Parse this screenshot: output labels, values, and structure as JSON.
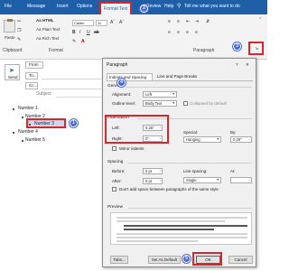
{
  "ribbon": {
    "tabs": [
      "File",
      "Message",
      "Insert",
      "Options",
      "Format Text",
      "Review",
      "Help"
    ],
    "search_text": "Tell me what you want to do",
    "format_group": {
      "as_html": "Aa HTML",
      "plain_text": "Aa Plain Text",
      "rich_text": "Aa Rich Text",
      "label": "Format"
    },
    "font": {
      "name": "Calibri",
      "size": "11"
    },
    "clipboard": {
      "paste": "Paste",
      "label": "Clipboard"
    },
    "paragraph_label": "Paragraph"
  },
  "email": {
    "from": "From",
    "to": "To...",
    "cc": "Cc...",
    "subject": "Subject",
    "send": "Send",
    "body": [
      "Number 1",
      "Number 2",
      "Number 3",
      "Number 4",
      "Number 5"
    ]
  },
  "callouts": [
    "1",
    "2",
    "3",
    "4",
    "5"
  ],
  "dialog": {
    "title": "Paragraph",
    "close": "✕",
    "help": "?",
    "tabs": [
      "Indents and Spacing",
      "Line and Page Breaks"
    ],
    "general": {
      "heading": "General",
      "alignment_label": "Alignment:",
      "alignment_value": "Left",
      "outline_label": "Outline level:",
      "outline_value": "Body Text",
      "collapsed": "Collapsed by default"
    },
    "indentation": {
      "heading": "Indentation",
      "left_label": "Left:",
      "left_value": "0.25\"",
      "right_label": "Right:",
      "right_value": "0\"",
      "special_label": "Special:",
      "special_value": "Hanging",
      "by_label": "By:",
      "by_value": "0.25\"",
      "mirror": "Mirror indents"
    },
    "spacing": {
      "heading": "Spacing",
      "before_label": "Before:",
      "before_value": "0 pt",
      "after_label": "After:",
      "after_value": "0 pt",
      "line_label": "Line spacing:",
      "line_value": "Single",
      "at_label": "At:",
      "dont_add": "Don't add space between paragraphs of the same style"
    },
    "preview_heading": "Preview",
    "buttons": {
      "tabs": "Tabs...",
      "set_default": "Set As Default",
      "ok": "OK",
      "cancel": "Cancel"
    }
  },
  "colors": {
    "accent": "#1f5fa8",
    "callout": "#4b6bd2",
    "highlight": "#d9252e"
  }
}
